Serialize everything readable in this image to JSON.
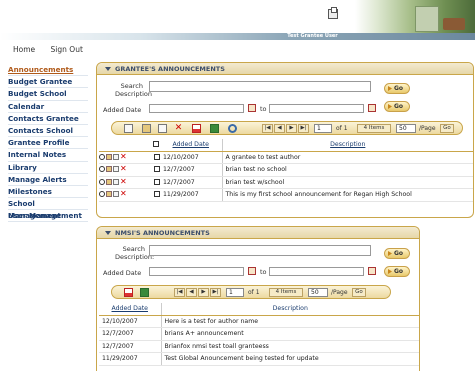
{
  "header": {
    "user_label": "Test Grantee User"
  },
  "topnav": {
    "home": "Home",
    "signout": "Sign Out"
  },
  "sidebar": {
    "items": [
      {
        "label": "Announcements"
      },
      {
        "label": "Budget Grantee"
      },
      {
        "label": "Budget School"
      },
      {
        "label": "Calendar"
      },
      {
        "label": "Contacts Grantee"
      },
      {
        "label": "Contacts School"
      },
      {
        "label": "Grantee Profile"
      },
      {
        "label": "Internal Notes"
      },
      {
        "label": "Library"
      },
      {
        "label": "Manage Alerts"
      },
      {
        "label": "Milestones"
      },
      {
        "label": "School Management"
      },
      {
        "label": "User Management"
      }
    ]
  },
  "grantee": {
    "title": "GRANTEE'S ANNOUNCEMENTS",
    "search_label": "Search Description",
    "search_value": "",
    "added_date_label": "Added Date",
    "to_label": "to",
    "go_label": "Go",
    "pager": {
      "page": "1",
      "of": "of 1",
      "items": "4 Items",
      "per_page": "50",
      "per_page_label": "/Page",
      "go": "Go"
    },
    "columns": {
      "added_date": "Added Date",
      "description": "Description"
    },
    "rows": [
      {
        "date": "12/10/2007",
        "desc": "A grantee to test author"
      },
      {
        "date": "12/7/2007",
        "desc": "brian test no school"
      },
      {
        "date": "12/7/2007",
        "desc": "brian test w/school"
      },
      {
        "date": "11/29/2007",
        "desc": "This is my first school announcement for Regan High School"
      }
    ]
  },
  "nmsi": {
    "title": "NMSI'S ANNOUNCEMENTS",
    "search_label": "Search Description:",
    "added_date_label": "Added Date",
    "to_label": "to",
    "go_label": "Go",
    "pager": {
      "page": "1",
      "of": "of 1",
      "items": "4 Items",
      "per_page": "50",
      "per_page_label": "/Page",
      "go": "Go"
    },
    "columns": {
      "added_date": "Added Date",
      "description": "Description"
    },
    "rows": [
      {
        "date": "12/10/2007",
        "desc": "Here is a test for author name"
      },
      {
        "date": "12/7/2007",
        "desc": "brians A+ announcement"
      },
      {
        "date": "12/7/2007",
        "desc": "Brianfox nmsi test toall granteess"
      },
      {
        "date": "11/29/2007",
        "desc": "Test Global Anouncement being tested for update"
      }
    ]
  },
  "icons": [
    "printer-icon",
    "calendar-icon",
    "new-icon",
    "edit-icon",
    "copy-icon",
    "delete-icon",
    "pdf-icon",
    "excel-icon",
    "refresh-icon",
    "first-page-icon",
    "prev-page-icon",
    "next-page-icon",
    "last-page-icon",
    "view-icon",
    "checkbox-icon"
  ]
}
